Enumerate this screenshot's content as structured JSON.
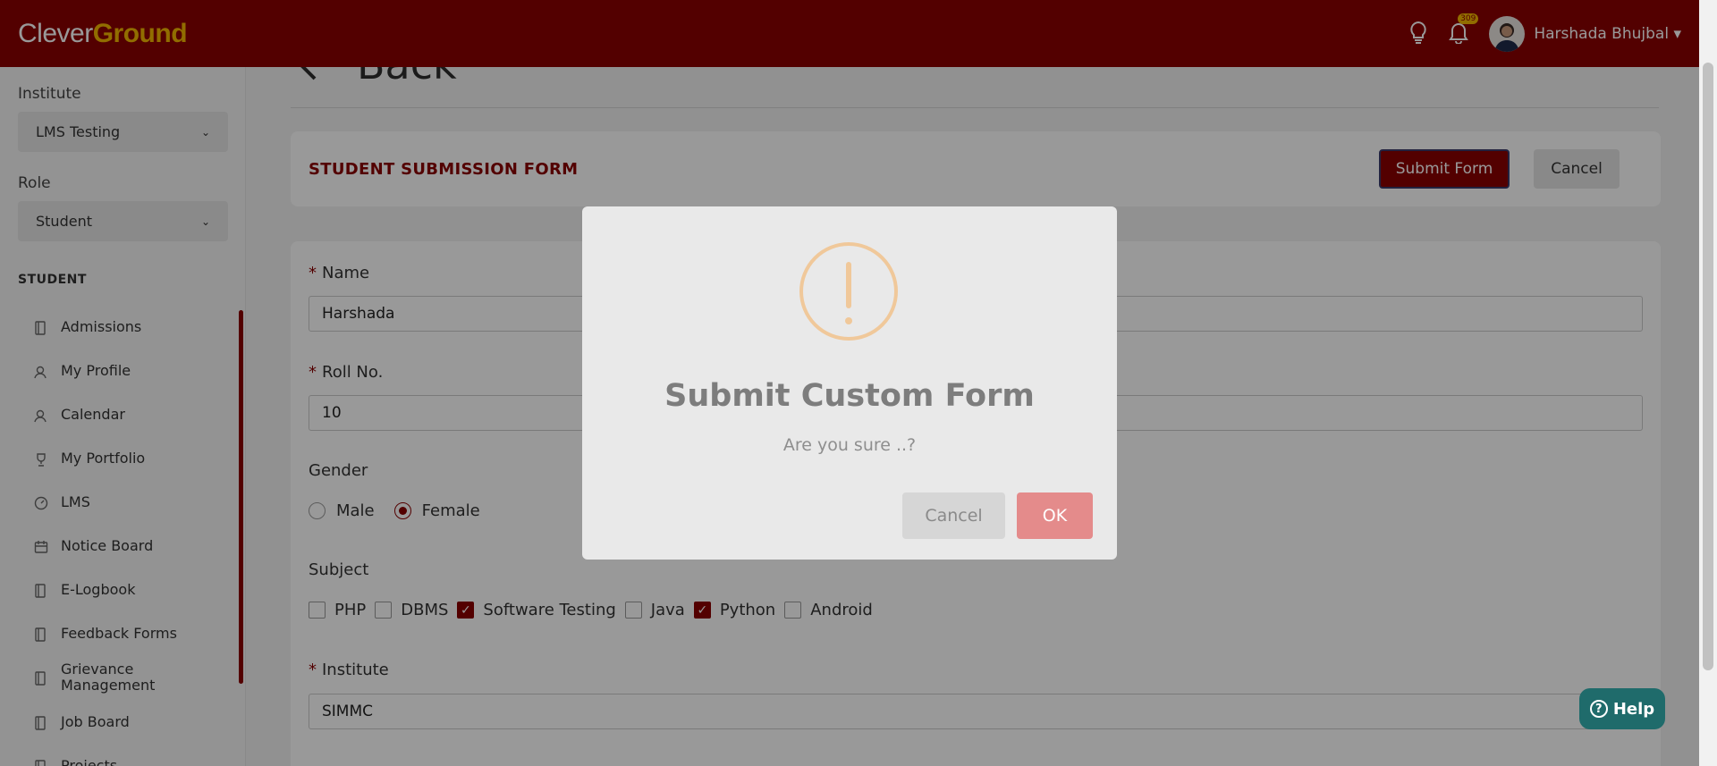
{
  "header": {
    "logo_part1": "Clever",
    "logo_part2": "Ground",
    "notification_count": "309",
    "user_name": "Harshada Bhujbal"
  },
  "sidebar": {
    "institute_label": "Institute",
    "institute_value": "LMS Testing",
    "role_label": "Role",
    "role_value": "Student",
    "section_title": "STUDENT",
    "items": [
      {
        "label": "Admissions",
        "icon": "document-icon"
      },
      {
        "label": "My Profile",
        "icon": "user-icon"
      },
      {
        "label": "Calendar",
        "icon": "user-icon"
      },
      {
        "label": "My Portfolio",
        "icon": "trophy-icon"
      },
      {
        "label": "LMS",
        "icon": "gauge-icon"
      },
      {
        "label": "Notice Board",
        "icon": "calendar-icon"
      },
      {
        "label": "E-Logbook",
        "icon": "document-icon"
      },
      {
        "label": "Feedback Forms",
        "icon": "document-icon"
      },
      {
        "label": "Grievance Management",
        "icon": "document-icon"
      },
      {
        "label": "Job Board",
        "icon": "document-icon"
      },
      {
        "label": "Projects",
        "icon": "document-icon"
      }
    ]
  },
  "page": {
    "back_label": "Back",
    "form_title": "STUDENT SUBMISSION FORM",
    "submit_label": "Submit Form",
    "cancel_label": "Cancel"
  },
  "form": {
    "name_label": "Name",
    "name_value": "Harshada",
    "roll_label": "Roll No.",
    "roll_value": "10",
    "gender_label": "Gender",
    "gender_options": [
      {
        "label": "Male",
        "selected": false
      },
      {
        "label": "Female",
        "selected": true
      }
    ],
    "subject_label": "Subject",
    "subjects": [
      {
        "label": "PHP",
        "checked": false
      },
      {
        "label": "DBMS",
        "checked": false
      },
      {
        "label": "Software Testing",
        "checked": true
      },
      {
        "label": "Java",
        "checked": false
      },
      {
        "label": "Python",
        "checked": true
      },
      {
        "label": "Android",
        "checked": false
      }
    ],
    "institute_label": "Institute",
    "institute_value": "SIMMC",
    "required_mark": "*"
  },
  "modal": {
    "title": "Submit Custom Form",
    "text": "Are you sure ..?",
    "cancel_label": "Cancel",
    "ok_label": "OK"
  },
  "help": {
    "label": "Help"
  },
  "colors": {
    "brand": "#8b0000",
    "accent": "#f2b600",
    "help": "#1f6b6b"
  }
}
